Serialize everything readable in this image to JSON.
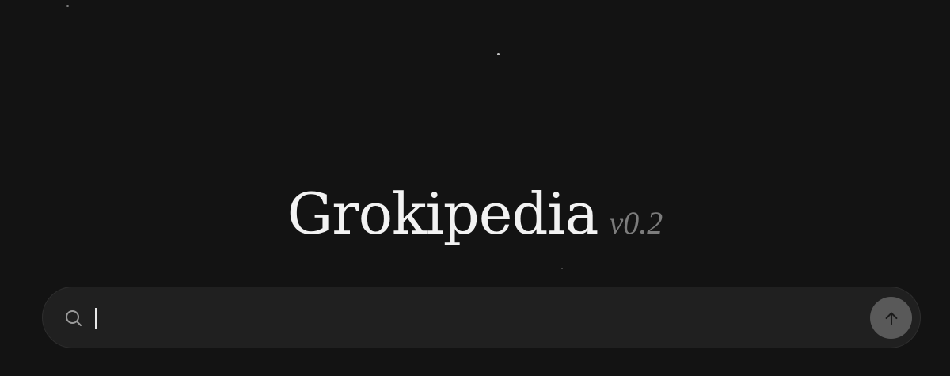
{
  "brand": {
    "name": "Grokipedia",
    "version": "v0.2"
  },
  "search": {
    "value": "",
    "placeholder": "",
    "submit_icon": "arrow-up-icon",
    "leading_icon": "search-icon"
  },
  "colors": {
    "background": "#131313",
    "search_bar": "#202020",
    "submit_button": "#595959",
    "title": "#f2f2f2",
    "version": "#7c7c7c"
  }
}
